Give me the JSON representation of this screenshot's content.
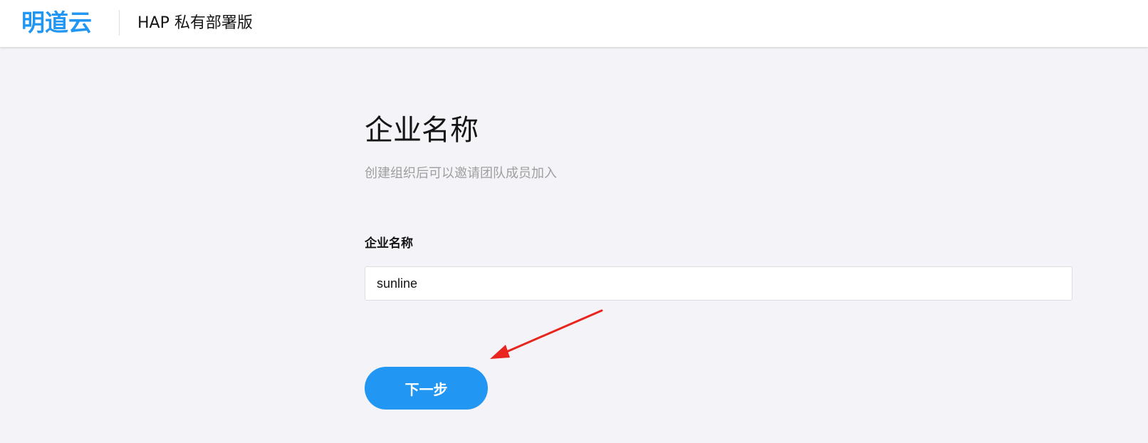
{
  "header": {
    "logo_text": "明道云",
    "product_name": "HAP 私有部署版"
  },
  "main": {
    "title": "企业名称",
    "subtitle": "创建组织后可以邀请团队成员加入",
    "field_label": "企业名称",
    "company_name_value": "sunline",
    "next_button_label": "下一步"
  },
  "colors": {
    "brand": "#2196f3",
    "background": "#f4f4f8",
    "annotation_arrow": "#e8251f"
  },
  "icons": {
    "annotation": "arrow-annotation-icon"
  }
}
